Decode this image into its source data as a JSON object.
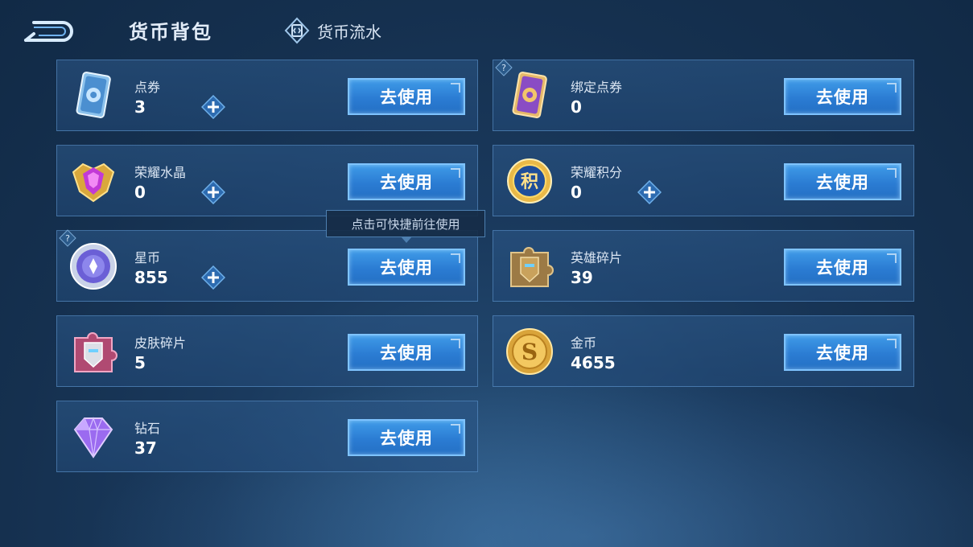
{
  "header": {
    "title": "货币背包",
    "flow_tab_label": "货币流水"
  },
  "tooltip": "点击可快捷前往使用",
  "use_label": "去使用",
  "currencies": [
    {
      "name": "点券",
      "amount": "3",
      "icon": "voucher-card-icon",
      "has_plus": true,
      "has_help": false
    },
    {
      "name": "绑定点券",
      "amount": "0",
      "icon": "bound-voucher-card-icon",
      "has_plus": false,
      "has_help": true
    },
    {
      "name": "荣耀水晶",
      "amount": "0",
      "icon": "glory-crystal-icon",
      "has_plus": true,
      "has_help": false
    },
    {
      "name": "荣耀积分",
      "amount": "0",
      "icon": "glory-points-coin-icon",
      "has_plus": true,
      "has_help": false
    },
    {
      "name": "星币",
      "amount": "855",
      "icon": "star-coin-icon",
      "has_plus": true,
      "has_help": true
    },
    {
      "name": "英雄碎片",
      "amount": "39",
      "icon": "hero-fragment-icon",
      "has_plus": false,
      "has_help": false
    },
    {
      "name": "皮肤碎片",
      "amount": "5",
      "icon": "skin-fragment-icon",
      "has_plus": false,
      "has_help": false
    },
    {
      "name": "金币",
      "amount": "4655",
      "icon": "gold-coin-icon",
      "has_plus": false,
      "has_help": false
    },
    {
      "name": "钻石",
      "amount": "37",
      "icon": "diamond-icon",
      "has_plus": false,
      "has_help": false
    }
  ],
  "icon_glyphs": {
    "points_coin": "积",
    "gold_coin": "S"
  },
  "colors": {
    "button": "#2b7cd3",
    "button_border": "#7ec3ff",
    "card_border": "#6eaae6",
    "background": "#15304f"
  }
}
